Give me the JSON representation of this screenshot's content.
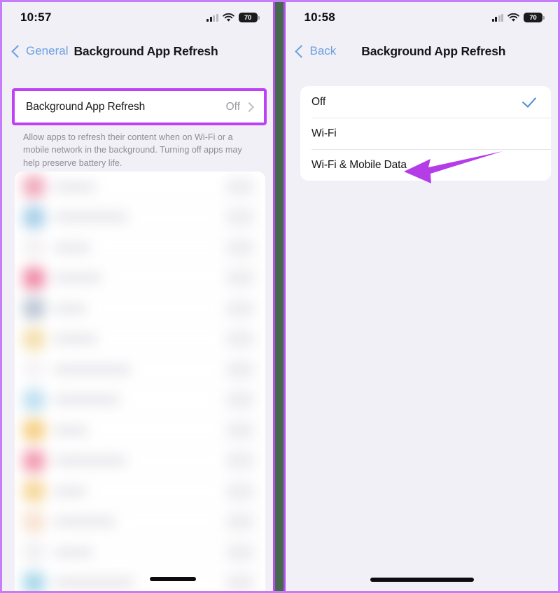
{
  "theme": {
    "background": "#f2f0f7",
    "card": "#ffffff",
    "accent_purple": "#bf41f5",
    "divider_green": "#44694b",
    "link_blue": "#6a9fe0",
    "check_blue": "#4a8fd4",
    "muted_text": "#9a9aa2"
  },
  "left_panel": {
    "status_bar": {
      "time": "10:57",
      "signal_icon": "cellular-signal-icon",
      "wifi_icon": "wifi-icon",
      "battery_icon": "battery-icon",
      "battery_level": "70"
    },
    "nav": {
      "back_label": "General",
      "back_icon": "chevron-left-icon",
      "title": "Background App Refresh"
    },
    "highlighted_row": {
      "label": "Background App Refresh",
      "value": "Off",
      "disclosure_icon": "chevron-right-icon"
    },
    "footnote": "Allow apps to refresh their content when on Wi-Fi or a mobile network in the background. Turning off apps may help preserve battery life.",
    "app_list_blurred": true,
    "app_rows": [
      {
        "icon_color": "#f0a9bc",
        "name_width": 62
      },
      {
        "icon_color": "#a8cfe8",
        "name_width": 108
      },
      {
        "icon_color": "#f4f2f4",
        "name_width": 54
      },
      {
        "icon_color": "#ef8ba8",
        "name_width": 70
      },
      {
        "icon_color": "#bfc8d6",
        "name_width": 48
      },
      {
        "icon_color": "#f4dfae",
        "name_width": 64
      },
      {
        "icon_color": "#f6f4f6",
        "name_width": 112
      },
      {
        "icon_color": "#bfe0f0",
        "name_width": 96
      },
      {
        "icon_color": "#f6cf86",
        "name_width": 50
      },
      {
        "icon_color": "#f29ab0",
        "name_width": 106
      },
      {
        "icon_color": "#f6d79a",
        "name_width": 48
      },
      {
        "icon_color": "#f8e3d2",
        "name_width": 90
      },
      {
        "icon_color": "#f2f0f2",
        "name_width": 58
      },
      {
        "icon_color": "#a9d8ea",
        "name_width": 116
      }
    ]
  },
  "right_panel": {
    "status_bar": {
      "time": "10:58",
      "signal_icon": "cellular-signal-icon",
      "wifi_icon": "wifi-icon",
      "battery_icon": "battery-icon",
      "battery_level": "70"
    },
    "nav": {
      "back_label": "Back",
      "back_icon": "chevron-left-icon",
      "title": "Background App Refresh"
    },
    "options": [
      {
        "label": "Off",
        "selected": true
      },
      {
        "label": "Wi-Fi",
        "selected": false
      },
      {
        "label": "Wi-Fi & Mobile Data",
        "selected": false
      }
    ],
    "annotation": {
      "type": "arrow",
      "direction": "left",
      "color": "#b43de8",
      "points_to": "Wi-Fi & Mobile Data"
    }
  }
}
